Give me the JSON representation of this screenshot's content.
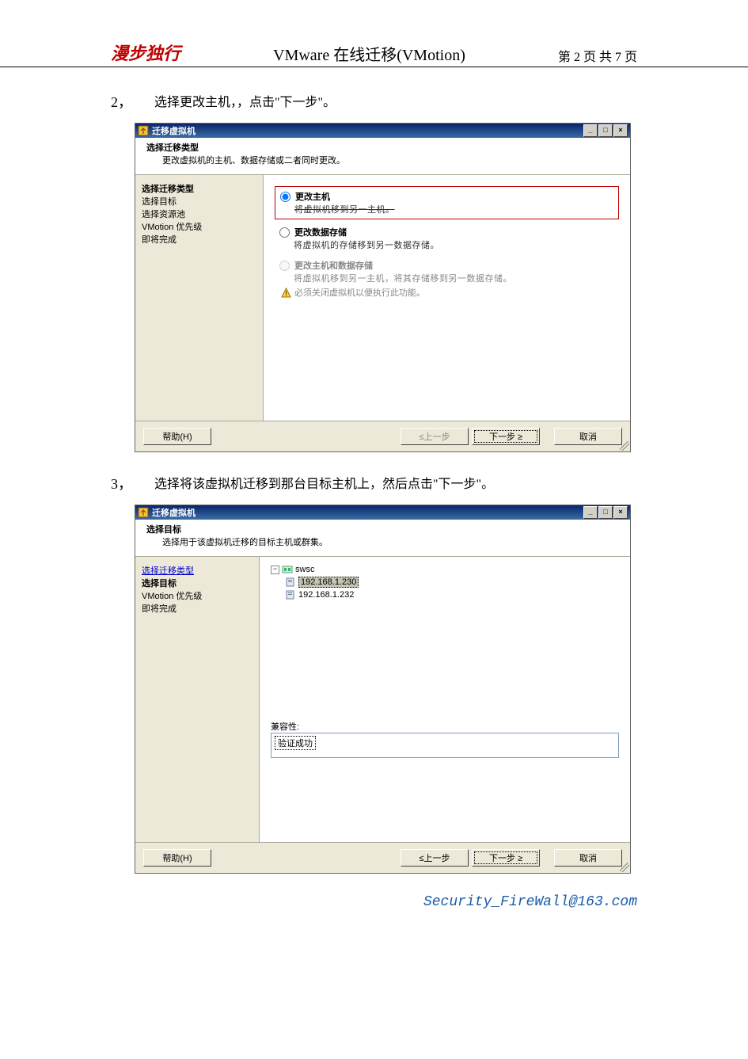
{
  "header": {
    "brand": "漫步独行",
    "title": "VMware 在线迁移(VMotion)",
    "page_label": "第 2 页 共 7 页"
  },
  "steps": {
    "s2": {
      "num": "2，",
      "text": "选择更改主机，，点击\"下一步\"。"
    },
    "s3": {
      "num": "3，",
      "text": "选择将该虚拟机迁移到那台目标主机上，然后点击\"下一步\"。"
    }
  },
  "dialog1": {
    "title": "迁移虚拟机",
    "panel_title": "选择迁移类型",
    "panel_sub": "更改虚拟机的主机、数据存储或二者同时更改。",
    "side": {
      "i1": "选择迁移类型",
      "i2": "选择目标",
      "i3": "选择资源池",
      "i4": "VMotion 优先级",
      "i5": "即将完成"
    },
    "opt1_label": "更改主机",
    "opt1_desc": "将虚拟机移到另一主机。",
    "opt2_label": "更改数据存储",
    "opt2_desc": "将虚拟机的存储移到另一数据存储。",
    "opt3_label": "更改主机和数据存储",
    "opt3_desc": "将虚拟机移到另一主机，将其存储移到另一数据存储。",
    "opt3_warn": "必须关闭虚拟机以便执行此功能。",
    "buttons": {
      "help": "帮助(H)",
      "back": "≤上一步",
      "next": "下一步 ≥",
      "cancel": "取消"
    }
  },
  "dialog2": {
    "title": "迁移虚拟机",
    "panel_title": "选择目标",
    "panel_sub": "选择用于该虚拟机迁移的目标主机或群集。",
    "side": {
      "i1": "选择迁移类型",
      "i2": "选择目标",
      "i3": "VMotion 优先级",
      "i4": "即将完成"
    },
    "tree": {
      "root": "swsc",
      "h1": "192.168.1.230",
      "h2": "192.168.1.232"
    },
    "compat_label": "兼容性:",
    "compat_value": "验证成功",
    "buttons": {
      "help": "帮助(H)",
      "back": "≤上一步",
      "next": "下一步 ≥",
      "cancel": "取消"
    }
  },
  "footer_email": "Security_FireWall@163.com"
}
